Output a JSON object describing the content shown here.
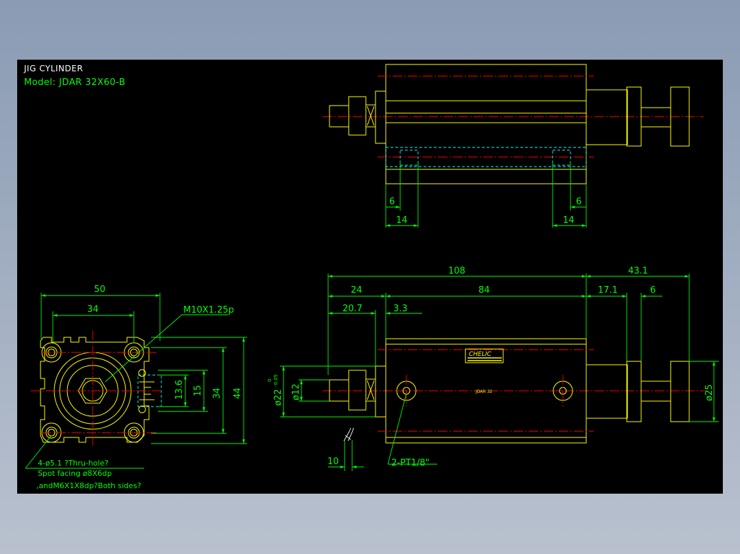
{
  "title": {
    "line1": "JIG CYLINDER",
    "line2": "Model:  JDAR  32X60-B"
  },
  "top_view": {
    "dims": [
      "6",
      "14",
      "6",
      "14"
    ]
  },
  "front_view": {
    "dims": [
      "50",
      "34",
      "13.6",
      "15",
      "34",
      "44"
    ],
    "thread_label": "M10X1.25p",
    "note": [
      "4-ø5.1 ?Thru-hole?",
      "Spot facing  ø8X6dp",
      ",andM6X1X8dp?Both sides?"
    ]
  },
  "side_view": {
    "dims": [
      "108",
      "43.1",
      "24",
      "84",
      "17.1",
      "6",
      "20.7",
      "3.3",
      "10"
    ],
    "dia": [
      "ø22",
      "ø12",
      "ø25"
    ],
    "tol": [
      "0",
      "-0.05"
    ],
    "port_label": "2-PT1/8\"",
    "body_label": "JDAR  32",
    "brand": "CHELIC"
  },
  "colors": {
    "background": "#000000",
    "outline": "#ffff00",
    "dimension": "#00ff00",
    "centerline": "#ff0000",
    "hidden": "#00ffff"
  }
}
